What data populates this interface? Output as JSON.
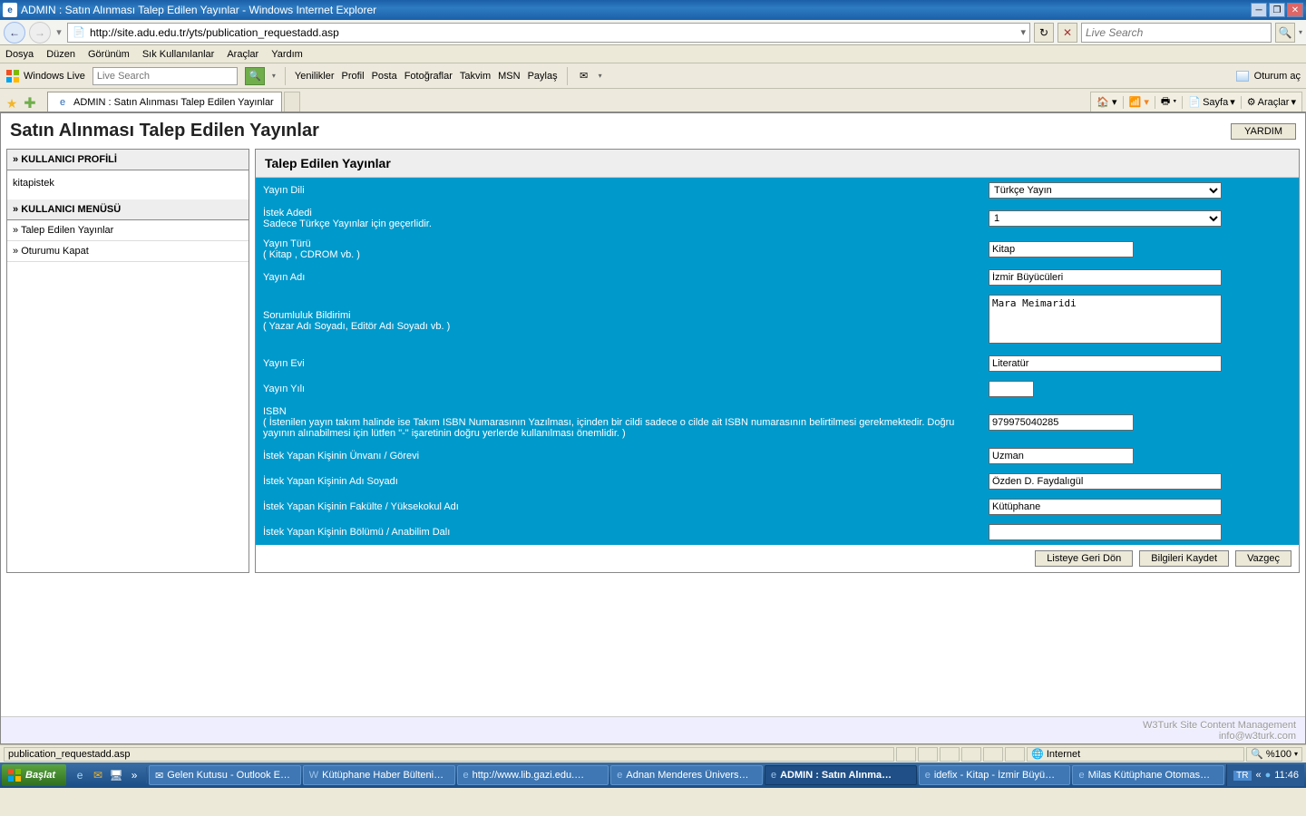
{
  "titlebar": {
    "title": "ADMIN : Satın Alınması Talep Edilen Yayınlar - Windows Internet Explorer"
  },
  "address": {
    "url": "http://site.adu.edu.tr/yts/publication_requestadd.asp"
  },
  "searchbox": {
    "placeholder": "Live Search"
  },
  "menubar": {
    "items": [
      "Dosya",
      "Düzen",
      "Görünüm",
      "Sık Kullanılanlar",
      "Araçlar",
      "Yardım"
    ]
  },
  "wl": {
    "brand": "Windows Live",
    "search_ph": "Live Search",
    "links": [
      "Yenilikler",
      "Profil",
      "Posta",
      "Fotoğraflar",
      "Takvim",
      "MSN",
      "Paylaş"
    ],
    "signin": "Oturum aç"
  },
  "tab": {
    "title": "ADMIN : Satın Alınması Talep Edilen Yayınlar"
  },
  "tabtools": {
    "sayfa": "Sayfa",
    "araclar": "Araçlar"
  },
  "page": {
    "heading": "Satın Alınması Talep Edilen Yayınlar",
    "help": "YARDIM",
    "sidebar": {
      "profile_hdr": "KULLANICI PROFİLİ",
      "user": "kitapistek",
      "menu_hdr": "KULLANICI MENÜSÜ",
      "items": [
        "Talep Edilen Yayınlar",
        "Oturumu Kapat"
      ]
    },
    "panel_hdr": "Talep Edilen Yayınlar",
    "form": {
      "lang_lbl": "Yayın Dili",
      "lang_val": "Türkçe Yayın",
      "qty_lbl": "İstek Adedi",
      "qty_sub": "Sadece Türkçe Yayınlar için geçerlidir.",
      "qty_val": "1",
      "type_lbl": "Yayın Türü",
      "type_sub": "( Kitap , CDROM vb. )",
      "type_val": "Kitap",
      "title_lbl": "Yayın Adı",
      "title_val": "İzmir Büyücüleri",
      "resp_lbl": "Sorumluluk Bildirimi",
      "resp_sub": "( Yazar Adı Soyadı, Editör Adı Soyadı vb. )",
      "resp_val": "Mara Meimaridi",
      "pub_lbl": "Yayın Evi",
      "pub_val": "Literatür",
      "year_lbl": "Yayın Yılı",
      "year_val": "",
      "isbn_lbl": "ISBN",
      "isbn_sub": "( İstenilen yayın takım halinde ise Takım ISBN Numarasının Yazılması, içinden bir cildi sadece o cilde ait ISBN numarasının belirtilmesi gerekmektedir. Doğru yayının alınabilmesi için lütfen \"-\" işaretinin doğru yerlerde kullanılması önemlidir. )",
      "isbn_val": "979975040285",
      "req_title_lbl": "İstek Yapan Kişinin Ünvanı / Görevi",
      "req_title_val": "Uzman",
      "req_name_lbl": "İstek Yapan Kişinin Adı Soyadı",
      "req_name_val": "Özden D. Faydalıgül",
      "req_fac_lbl": "İstek Yapan Kişinin Fakülte / Yüksekokul Adı",
      "req_fac_val": "Kütüphane",
      "req_dept_lbl": "İstek Yapan Kişinin Bölümü / Anabilim Dalı",
      "req_dept_val": ""
    },
    "buttons": {
      "back": "Listeye Geri Dön",
      "save": "Bilgileri Kaydet",
      "cancel": "Vazgeç"
    },
    "footer": {
      "l1": "W3Turk Site Content Management",
      "l2": "info@w3turk.com"
    }
  },
  "status": {
    "left": "publication_requestadd.asp",
    "zone": "Internet",
    "zoom": "%100"
  },
  "taskbar": {
    "start": "Başlat",
    "tasks": [
      "Gelen Kutusu - Outlook E…",
      "Kütüphane Haber Bülteni…",
      "http://www.lib.gazi.edu.…",
      "Adnan Menderes Ünivers…",
      "ADMIN : Satın Alınma…",
      "idefix - Kitap - İzmir Büyü…",
      "Milas Kütüphane Otomas…"
    ],
    "active_idx": 4,
    "lang": "TR",
    "time": "11:46"
  }
}
